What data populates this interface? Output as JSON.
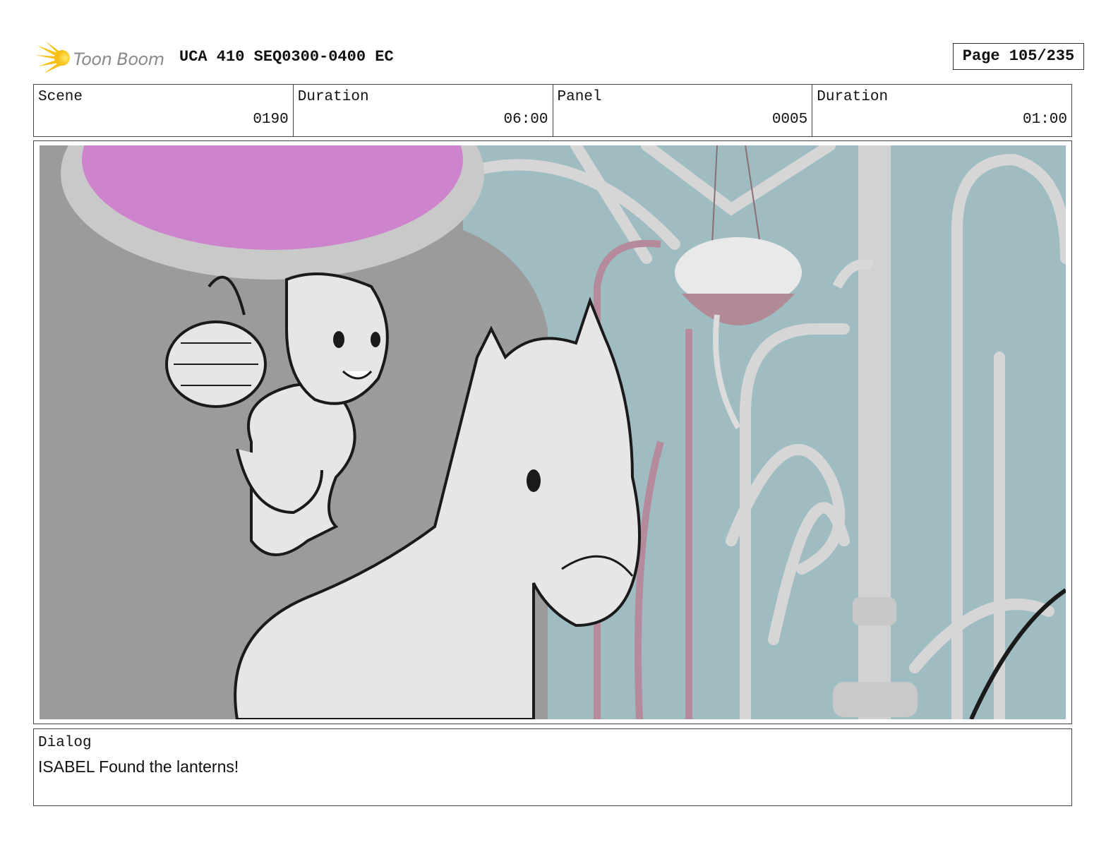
{
  "header": {
    "logo_text": "Toon Boom",
    "title": "UCA 410 SEQ0300-0400 EC",
    "page": "Page 105/235"
  },
  "info": {
    "scene_label": "Scene",
    "scene_value": "0190",
    "scene_duration_label": "Duration",
    "scene_duration_value": "06:00",
    "panel_label": "Panel",
    "panel_value": "0005",
    "panel_duration_label": "Duration",
    "panel_duration_value": "01:00"
  },
  "panel": {
    "colors": {
      "wall": "#9b9b9b",
      "window": "#cd84cc",
      "glass": "#9fbcc2",
      "trellis": "#d8d8d8",
      "sketch_fill": "#e6e6e6",
      "line": "#1a1a1a",
      "pot": "#b08a95"
    }
  },
  "dialog": {
    "label": "Dialog",
    "text": "ISABEL Found the lanterns!"
  }
}
